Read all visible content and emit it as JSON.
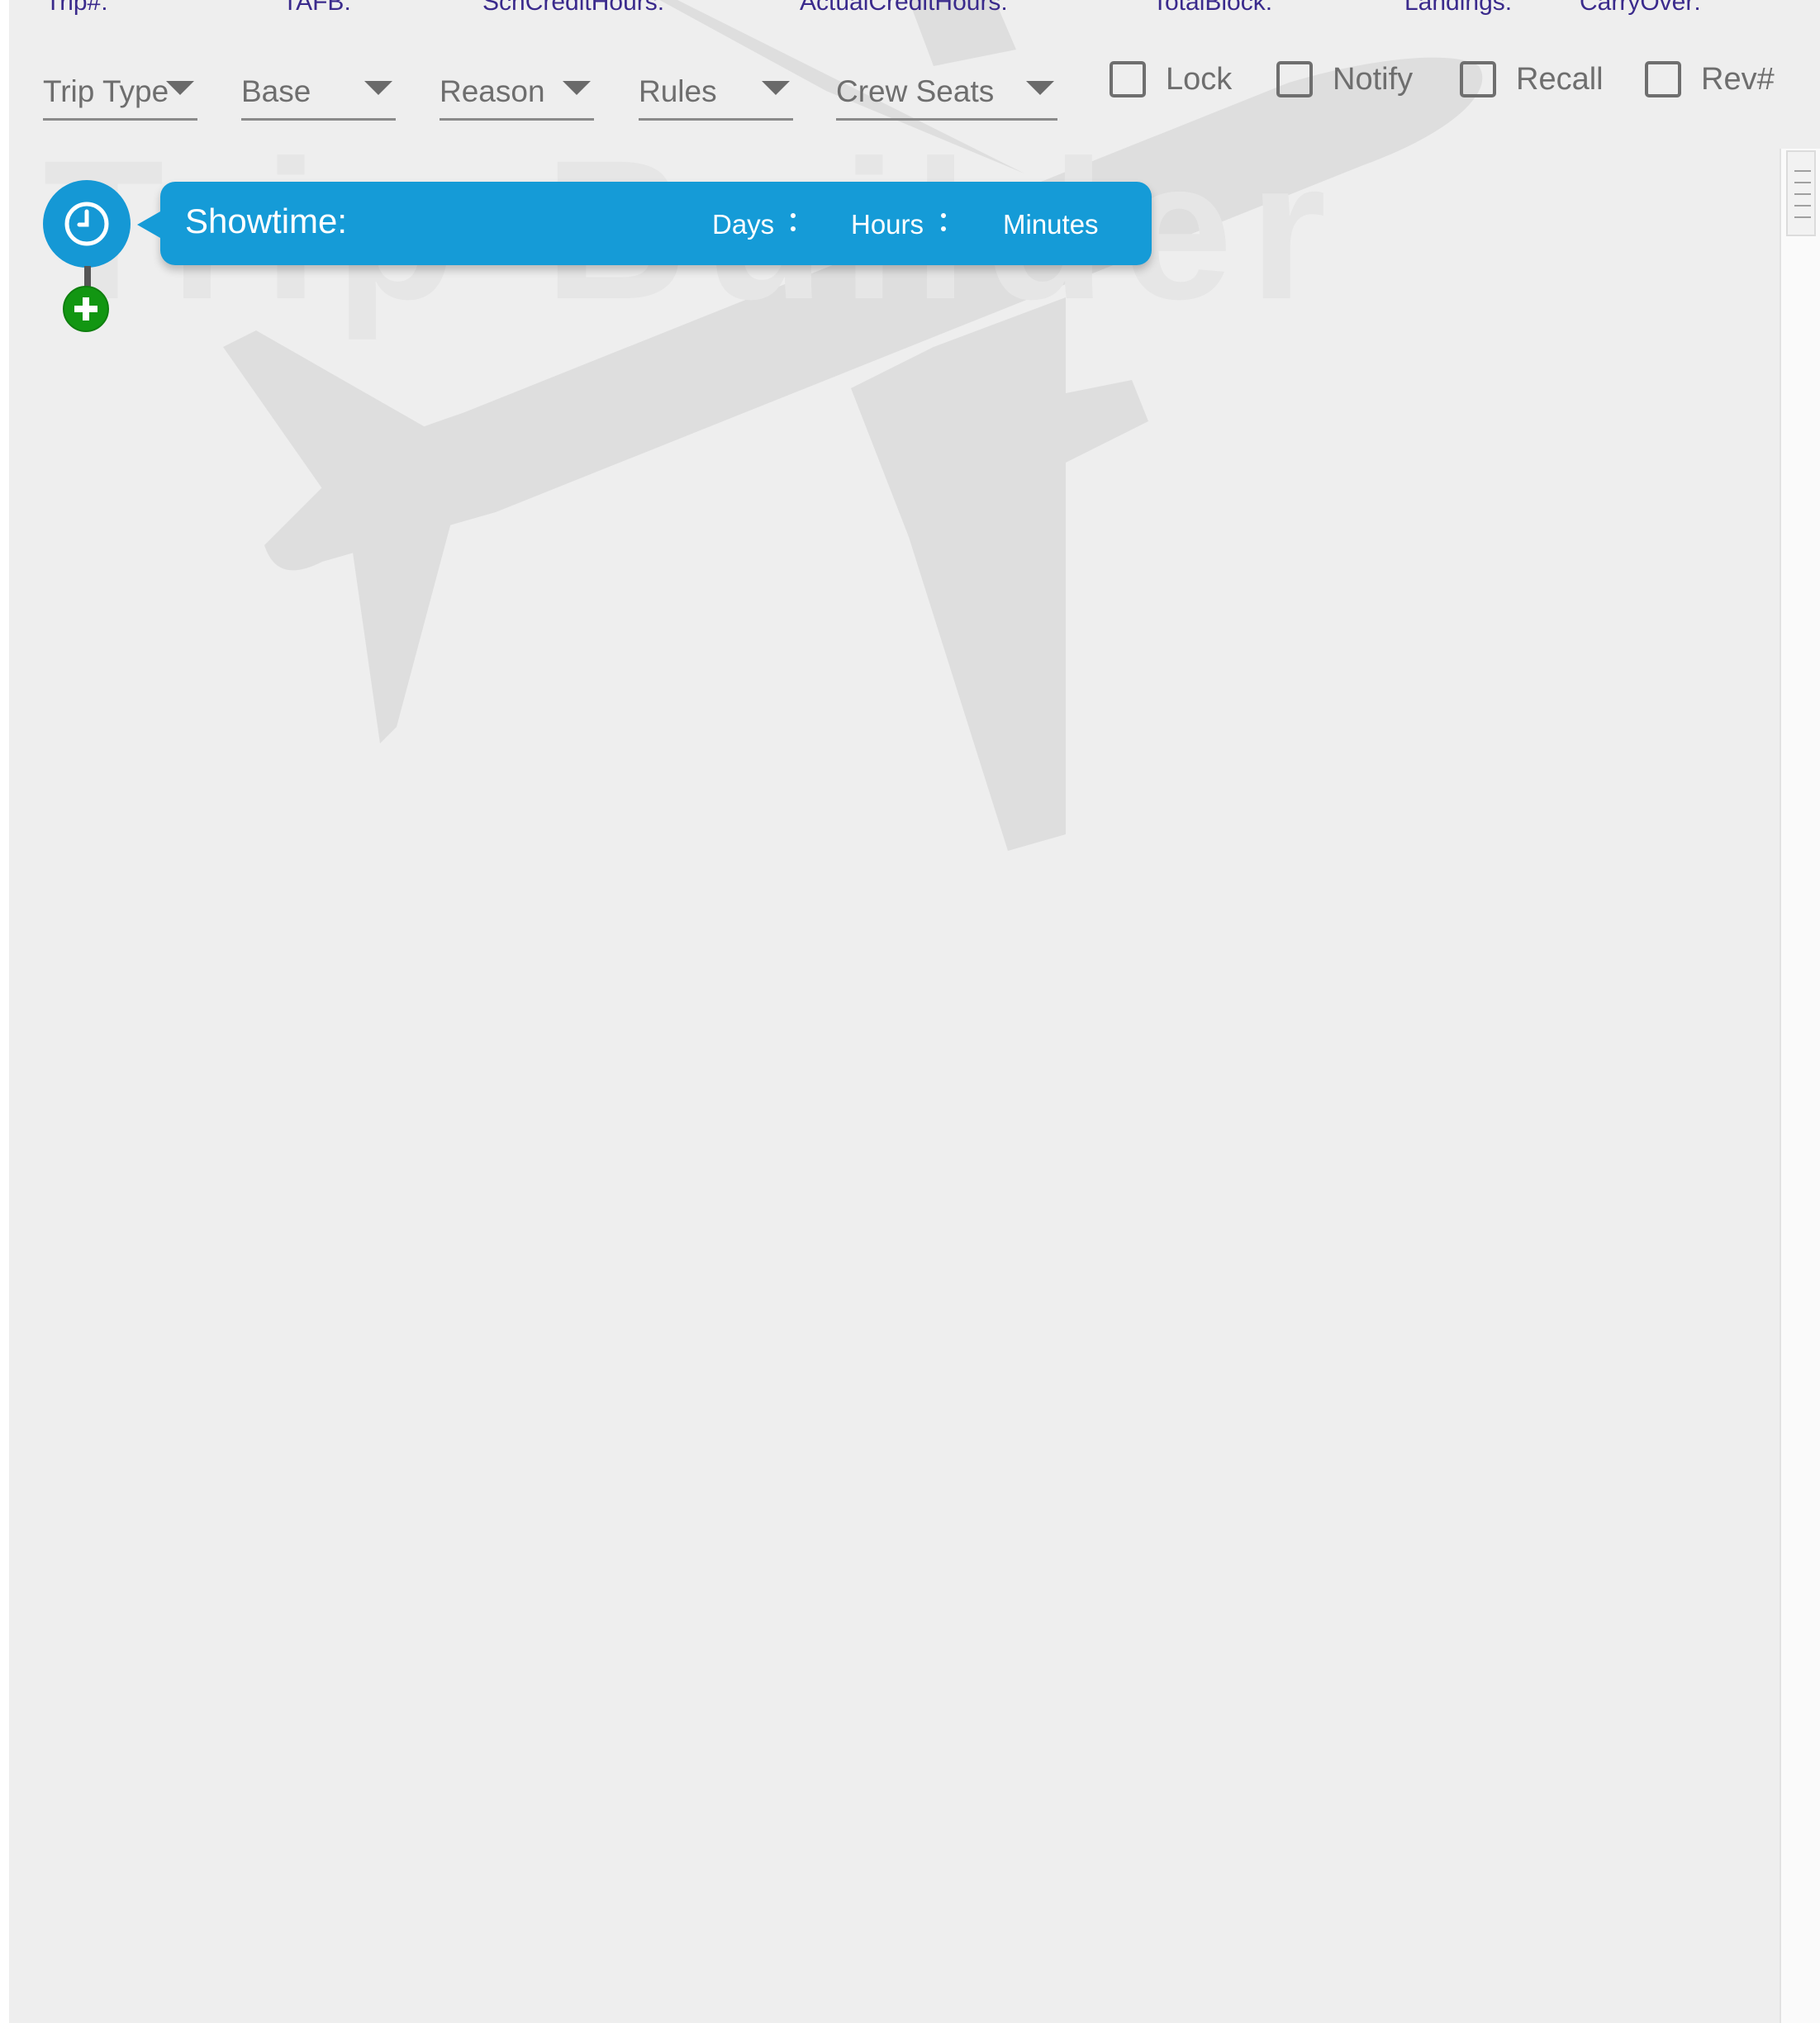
{
  "header_stats": [
    {
      "label": "Trip#:"
    },
    {
      "label": "TAFB:"
    },
    {
      "label": "SchCreditHours:"
    },
    {
      "label": "ActualCreditHours:"
    },
    {
      "label": "TotalBlock:"
    },
    {
      "label": "Landings:"
    },
    {
      "label": "CarryOver:"
    }
  ],
  "filters": {
    "dropdowns": [
      {
        "label": "Trip Type"
      },
      {
        "label": "Base"
      },
      {
        "label": "Reason"
      },
      {
        "label": "Rules"
      },
      {
        "label": "Crew Seats"
      }
    ],
    "checkboxes": [
      {
        "label": "Lock",
        "checked": false
      },
      {
        "label": "Notify",
        "checked": false
      },
      {
        "label": "Recall",
        "checked": false
      },
      {
        "label": "Rev#",
        "checked": false
      }
    ]
  },
  "watermark": {
    "text": "Trip Builder",
    "icon": "airplane-icon"
  },
  "timeline": {
    "showtime_icon": "clock-icon",
    "add_icon": "plus-icon",
    "showtime": {
      "title": "Showtime:",
      "days_label": "Days",
      "hours_label": "Hours",
      "minutes_label": "Minutes"
    }
  },
  "colors": {
    "accent_blue": "#159bd7",
    "add_green": "#129612",
    "background": "#eeeeee",
    "label_gray": "#6e6e6e",
    "stat_purple": "#3a2a8c"
  }
}
